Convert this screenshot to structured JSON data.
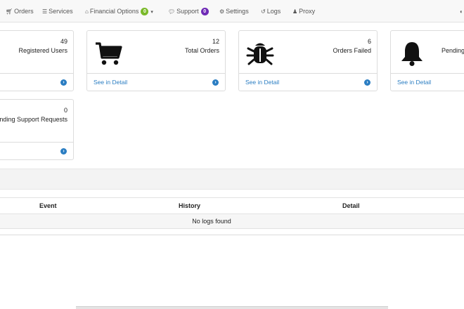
{
  "navbar": {
    "items": [
      {
        "label": "Orders",
        "icon": "cart-icon"
      },
      {
        "label": "Services",
        "icon": "list-icon"
      },
      {
        "label": "Financial Options",
        "icon": "bank-icon",
        "badge": "0",
        "badge_color": "#7ab929",
        "dropdown": true
      },
      {
        "label": "Support",
        "icon": "chat-icon",
        "badge": "0",
        "badge_color": "#6f2bb6"
      },
      {
        "label": "Settings",
        "icon": "gear-icon"
      },
      {
        "label": "Logs",
        "icon": "history-icon"
      },
      {
        "label": "Proxy",
        "icon": "user-secret-icon"
      }
    ]
  },
  "stats": [
    {
      "count": "49",
      "label": "Registered Users",
      "icon": "users-icon",
      "footer": ""
    },
    {
      "count": "12",
      "label": "Total Orders",
      "icon": "shopping-cart-icon",
      "footer": "See in Detail"
    },
    {
      "count": "6",
      "label": "Orders Failed",
      "icon": "bug-icon",
      "footer": "See in Detail"
    },
    {
      "count": "",
      "label": "Pending",
      "icon": "bell-icon",
      "footer": "See in Detail"
    },
    {
      "count": "0",
      "label": "Pending Support Requests",
      "icon": "",
      "footer": ""
    }
  ],
  "logs_table": {
    "columns": [
      "Event",
      "History",
      "Detail"
    ],
    "empty_message": "No logs found"
  },
  "colors": {
    "link": "#2a7dc2",
    "badge_green": "#7ab929",
    "badge_purple": "#6f2bb6"
  }
}
